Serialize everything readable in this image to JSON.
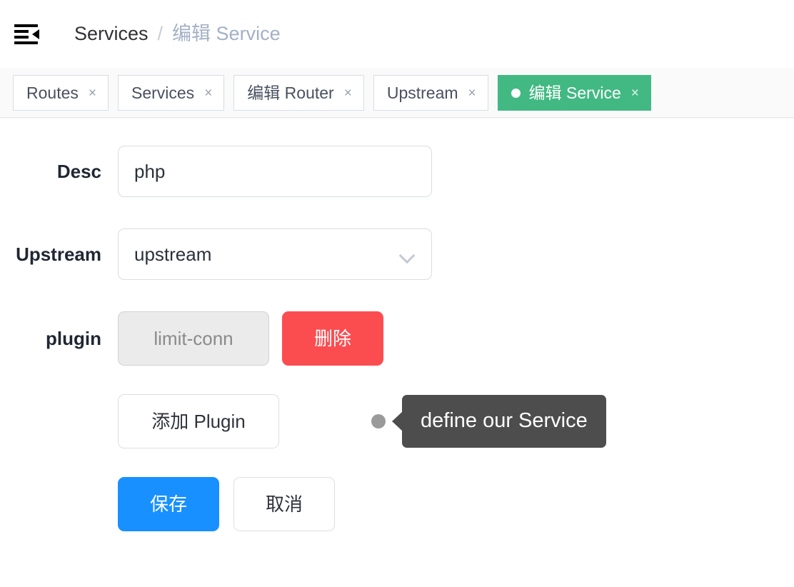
{
  "header": {
    "menu_icon": "menu-fold-icon",
    "breadcrumb": {
      "root": "Services",
      "separator": "/",
      "current": "编辑 Service"
    }
  },
  "tabs": [
    {
      "label": "Routes",
      "close": "×",
      "active": false
    },
    {
      "label": "Services",
      "close": "×",
      "active": false
    },
    {
      "label": "编辑 Router",
      "close": "×",
      "active": false
    },
    {
      "label": "Upstream",
      "close": "×",
      "active": false
    },
    {
      "label": "编辑 Service",
      "close": "×",
      "active": true
    }
  ],
  "form": {
    "desc": {
      "label": "Desc",
      "value": "php",
      "placeholder": "Desc"
    },
    "upstream": {
      "label": "Upstream",
      "value": "upstream",
      "chevron": "chevron-down-icon"
    },
    "plugin": {
      "label": "plugin",
      "name_button": "limit-conn",
      "delete_button": "删除"
    },
    "add_plugin_button": "添加 Plugin",
    "save_button": "保存",
    "cancel_button": "取消"
  },
  "callout": {
    "text": "define our Service"
  },
  "colors": {
    "active_tab_green": "#42b983",
    "delete_red": "#fb4d50",
    "save_blue": "#1890ff",
    "callout_gray": "#4d4d4d",
    "dot_gray": "#9a9a9a",
    "border_gray": "#d9dde3",
    "breadcrumb_current": "#a3b1c6"
  }
}
